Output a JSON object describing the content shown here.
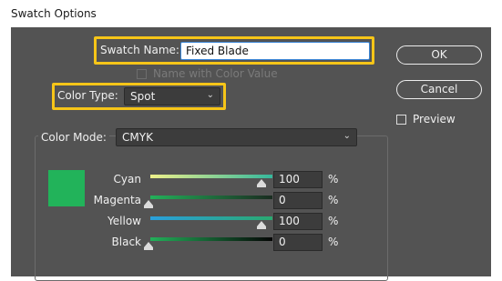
{
  "window": {
    "title": "Swatch Options"
  },
  "swatch_name": {
    "label": "Swatch Name:",
    "value": "Fixed Blade"
  },
  "name_with_color_value": {
    "label": "Name with Color Value",
    "checked": false,
    "enabled": false
  },
  "color_type": {
    "label": "Color Type:",
    "value": "Spot"
  },
  "buttons": {
    "ok": "OK",
    "cancel": "Cancel"
  },
  "preview": {
    "label": "Preview",
    "checked": false
  },
  "color_mode": {
    "label": "Color Mode:",
    "value": "CMYK"
  },
  "swatch_color": "#22b35a",
  "highlight_color": "#f6c518",
  "sliders": [
    {
      "label": "Cyan",
      "value": "100",
      "unit": "%"
    },
    {
      "label": "Magenta",
      "value": "0",
      "unit": "%"
    },
    {
      "label": "Yellow",
      "value": "100",
      "unit": "%"
    },
    {
      "label": "Black",
      "value": "0",
      "unit": "%"
    }
  ],
  "icons": {
    "dropdown": "chevron-down-icon",
    "slider_thumb": "slider-thumb-icon"
  }
}
